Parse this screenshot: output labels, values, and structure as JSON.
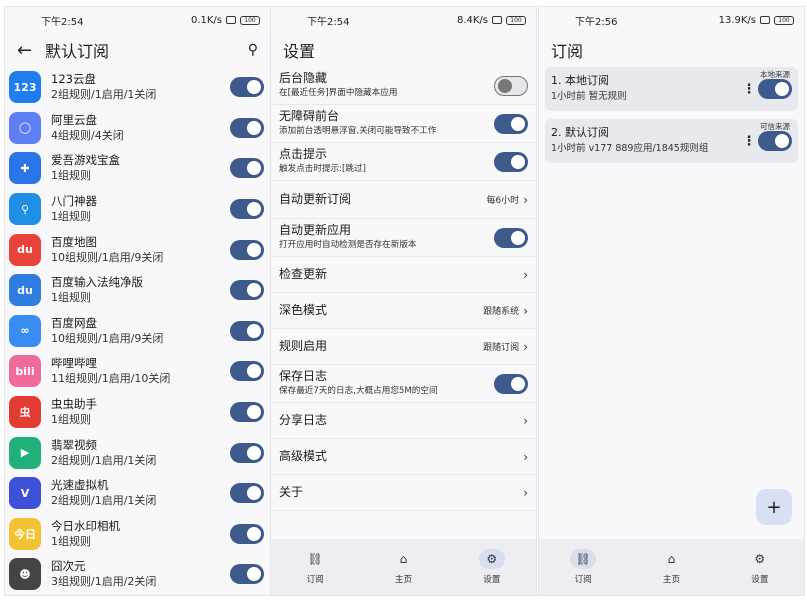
{
  "panel1": {
    "status": {
      "time": "下午2:54",
      "speed": "0.1K/s",
      "battery": "100"
    },
    "title": "默认订阅",
    "apps": [
      {
        "name": "123云盘",
        "sub": "2组规则/1启用/1关闭",
        "icon_text": "123",
        "color": "#1e7ef0"
      },
      {
        "name": "阿里云盘",
        "sub": "4组规则/4关闭",
        "icon_text": "◯",
        "color": "#5f7ff5"
      },
      {
        "name": "爱吾游戏宝盒",
        "sub": "1组规则",
        "icon_text": "✚",
        "color": "#2a76e8"
      },
      {
        "name": "八门神器",
        "sub": "1组规则",
        "icon_text": "⚲",
        "color": "#1f8fe6"
      },
      {
        "name": "百度地图",
        "sub": "10组规则/1启用/9关闭",
        "icon_text": "du",
        "color": "#e8423a"
      },
      {
        "name": "百度输入法纯净版",
        "sub": "1组规则",
        "icon_text": "du",
        "color": "#2f7de0"
      },
      {
        "name": "百度网盘",
        "sub": "10组规则/1启用/9关闭",
        "icon_text": "∞",
        "color": "#3a8df0"
      },
      {
        "name": "哔哩哔哩",
        "sub": "11组规则/1启用/10关闭",
        "icon_text": "bili",
        "color": "#f06a9b"
      },
      {
        "name": "虫虫助手",
        "sub": "1组规则",
        "icon_text": "虫",
        "color": "#e23b2f"
      },
      {
        "name": "翡翠视频",
        "sub": "2组规则/1启用/1关闭",
        "icon_text": "▶",
        "color": "#21b07a"
      },
      {
        "name": "光速虚拟机",
        "sub": "2组规则/1启用/1关闭",
        "icon_text": "V",
        "color": "#3e4fd8"
      },
      {
        "name": "今日水印相机",
        "sub": "1组规则",
        "icon_text": "今日",
        "color": "#f2c230"
      },
      {
        "name": "囧次元",
        "sub": "3组规则/1启用/2关闭",
        "icon_text": "☻",
        "color": "#444444"
      }
    ]
  },
  "panel2": {
    "status": {
      "time": "下午2:54",
      "speed": "8.4K/s",
      "battery": "100"
    },
    "title": "设置",
    "items": [
      {
        "title": "后台隐藏",
        "desc": "在[最近任务]界面中隐藏本应用",
        "type": "toggle",
        "on": false
      },
      {
        "title": "无障碍前台",
        "desc": "添加前台透明悬浮窗,关闭可能导致不工作",
        "type": "toggle",
        "on": true
      },
      {
        "title": "点击提示",
        "desc": "触发点击时提示:[跳过]",
        "type": "toggle",
        "on": true
      },
      {
        "title": "自动更新订阅",
        "value": "每6小时",
        "type": "chevron"
      },
      {
        "title": "自动更新应用",
        "desc": "打开应用时自动检测是否存在新版本",
        "type": "toggle",
        "on": true
      },
      {
        "title": "检查更新",
        "type": "chevron"
      },
      {
        "title": "深色模式",
        "value": "跟随系统",
        "type": "chevron"
      },
      {
        "title": "规则启用",
        "value": "跟随订阅",
        "type": "chevron"
      },
      {
        "title": "保存日志",
        "desc": "保存最近7天的日志,大概占用您5M的空间",
        "type": "toggle",
        "on": true
      },
      {
        "title": "分享日志",
        "type": "chevron"
      },
      {
        "title": "高级模式",
        "type": "chevron"
      },
      {
        "title": "关于",
        "type": "chevron"
      }
    ],
    "nav": [
      {
        "label": "订阅",
        "icon": "link-icon",
        "active": false
      },
      {
        "label": "主页",
        "icon": "home-icon",
        "active": false
      },
      {
        "label": "设置",
        "icon": "gear-icon",
        "active": true
      }
    ]
  },
  "panel3": {
    "status": {
      "time": "下午2:56",
      "speed": "13.9K/s",
      "battery": "100"
    },
    "title": "订阅",
    "subs": [
      {
        "title": "1. 本地订阅",
        "meta": "1小时前   暂无规则",
        "badge": "本地来源"
      },
      {
        "title": "2. 默认订阅",
        "meta": "1小时前   v177   889应用/1845规则组",
        "badge": "可信来源"
      }
    ],
    "fab": "+",
    "nav": [
      {
        "label": "订阅",
        "icon": "link-icon",
        "active": true
      },
      {
        "label": "主页",
        "icon": "home-icon",
        "active": false
      },
      {
        "label": "设置",
        "icon": "gear-icon",
        "active": false
      }
    ]
  }
}
